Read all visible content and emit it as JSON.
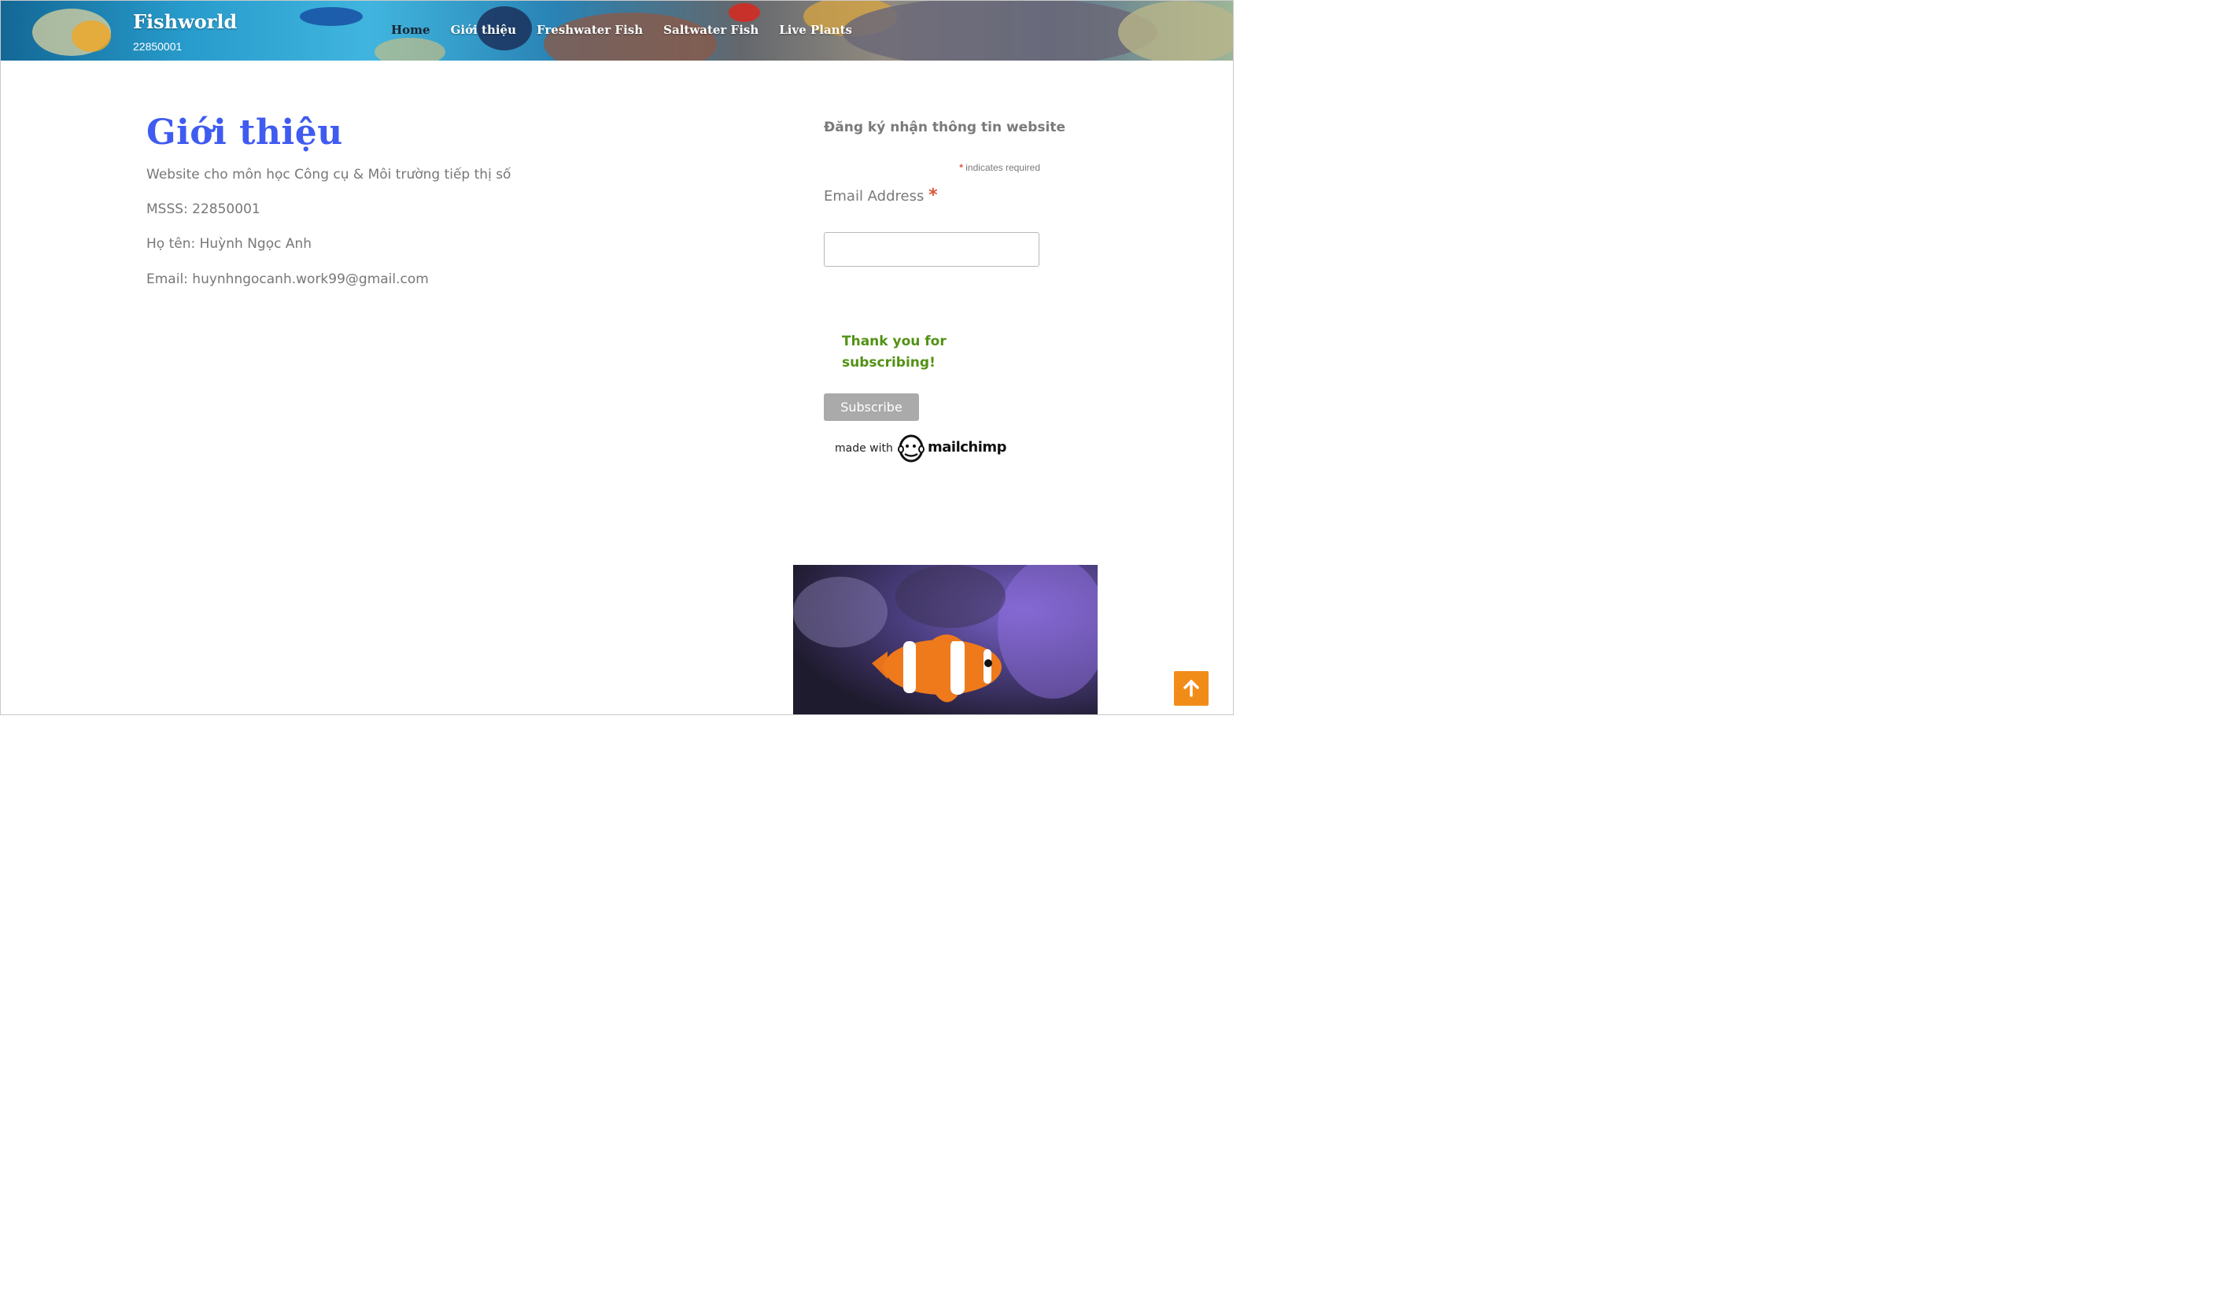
{
  "header": {
    "site_title": "Fishworld",
    "tagline": "22850001",
    "nav": [
      {
        "label": "Home"
      },
      {
        "label": "Giới thiệu"
      },
      {
        "label": "Freshwater Fish"
      },
      {
        "label": "Saltwater Fish"
      },
      {
        "label": "Live Plants"
      }
    ]
  },
  "main": {
    "title": "Giới thiệu",
    "paragraphs": [
      "Website cho môn học Công cụ & Môi trường tiếp thị số",
      "MSSS: 22850001",
      "Họ tên: Huỳnh Ngọc Anh",
      "Email: huynhngocanh.work99@gmail.com"
    ]
  },
  "sidebar": {
    "signup": {
      "title": "Đăng ký nhận thông tin website",
      "required_asterisk": "*",
      "required_note": "indicates required",
      "email_label": "Email Address",
      "email_value": "",
      "thanks_message": "Thank you for subscribing!",
      "subscribe_label": "Subscribe",
      "made_with": "made with",
      "mailchimp": "mailchimp"
    },
    "image": {
      "icon": "clownfish-photo"
    }
  },
  "back_to_top": {
    "icon": "arrow-up-icon"
  },
  "colors": {
    "title_blue": "#3f5bf0",
    "success_green": "#529214",
    "accent_orange": "#f28c18",
    "required_red": "#e0543b"
  }
}
